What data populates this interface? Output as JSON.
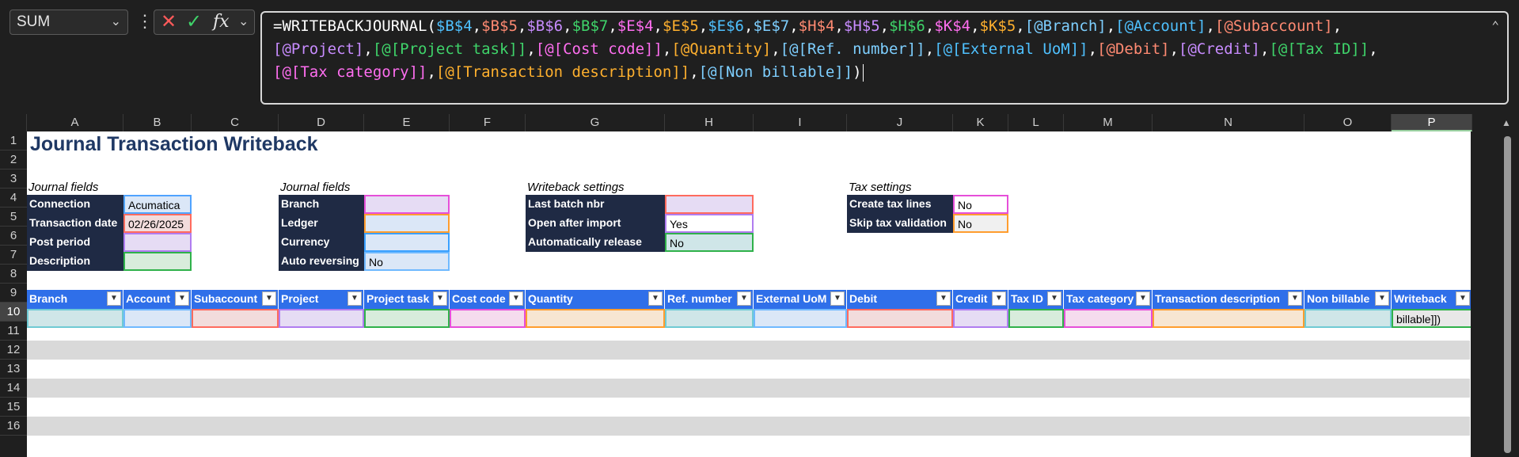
{
  "namebox": {
    "value": "SUM",
    "icon": "chevron-down-icon"
  },
  "formula_bar": {
    "menu_icon": "vertical-dots-icon",
    "cancel_icon": "cancel-x-icon",
    "enter_icon": "checkmark-icon",
    "fx_label": "fx",
    "fx_chevron": "chevron-down-icon",
    "collapse_icon": "chevron-up-icon",
    "tokens": [
      {
        "t": "=WRITEBACKJOURNAL(",
        "c": "w"
      },
      {
        "t": "$B$4",
        "c": "c1"
      },
      {
        "t": ",",
        "c": "w"
      },
      {
        "t": "$B$5",
        "c": "c2"
      },
      {
        "t": ",",
        "c": "w"
      },
      {
        "t": "$B$6",
        "c": "c7"
      },
      {
        "t": ",",
        "c": "w"
      },
      {
        "t": "$B$7",
        "c": "c3"
      },
      {
        "t": ",",
        "c": "w"
      },
      {
        "t": "$E$4",
        "c": "c4"
      },
      {
        "t": ",",
        "c": "w"
      },
      {
        "t": "$E$5",
        "c": "c5"
      },
      {
        "t": ",",
        "c": "w"
      },
      {
        "t": "$E$6",
        "c": "c1"
      },
      {
        "t": ",",
        "c": "w"
      },
      {
        "t": "$E$7",
        "c": "c6"
      },
      {
        "t": ",",
        "c": "w"
      },
      {
        "t": "$H$4",
        "c": "c2"
      },
      {
        "t": ",",
        "c": "w"
      },
      {
        "t": "$H$5",
        "c": "c7"
      },
      {
        "t": ",",
        "c": "w"
      },
      {
        "t": "$H$6",
        "c": "c3"
      },
      {
        "t": ",",
        "c": "w"
      },
      {
        "t": "$K$4",
        "c": "c4"
      },
      {
        "t": ",",
        "c": "w"
      },
      {
        "t": "$K$5",
        "c": "c5"
      },
      {
        "t": ",",
        "c": "w"
      },
      {
        "t": "[@Branch]",
        "c": "c6"
      },
      {
        "t": ",",
        "c": "w"
      },
      {
        "t": "[@Account]",
        "c": "c1"
      },
      {
        "t": ",",
        "c": "w"
      },
      {
        "t": "[@Subaccount]",
        "c": "c2"
      },
      {
        "t": ",\n",
        "c": "w"
      },
      {
        "t": "[@Project]",
        "c": "c7"
      },
      {
        "t": ",",
        "c": "w"
      },
      {
        "t": "[@[Project task]]",
        "c": "c3"
      },
      {
        "t": ",",
        "c": "w"
      },
      {
        "t": "[@[Cost code]]",
        "c": "c4"
      },
      {
        "t": ",",
        "c": "w"
      },
      {
        "t": "[@Quantity]",
        "c": "c5"
      },
      {
        "t": ",",
        "c": "w"
      },
      {
        "t": "[@[Ref. number]]",
        "c": "c6"
      },
      {
        "t": ",",
        "c": "w"
      },
      {
        "t": "[@[External UoM]]",
        "c": "c1"
      },
      {
        "t": ",",
        "c": "w"
      },
      {
        "t": "[@Debit]",
        "c": "c2"
      },
      {
        "t": ",",
        "c": "w"
      },
      {
        "t": "[@Credit]",
        "c": "c7"
      },
      {
        "t": ",",
        "c": "w"
      },
      {
        "t": "[@[Tax ID]]",
        "c": "c3"
      },
      {
        "t": ",\n",
        "c": "w"
      },
      {
        "t": "[@[Tax category]]",
        "c": "c4"
      },
      {
        "t": ",",
        "c": "w"
      },
      {
        "t": "[@[Transaction description]]",
        "c": "c5"
      },
      {
        "t": ",",
        "c": "w"
      },
      {
        "t": "[@[Non billable]]",
        "c": "c6"
      },
      {
        "t": ")",
        "c": "w"
      }
    ]
  },
  "columns": [
    "A",
    "B",
    "C",
    "D",
    "E",
    "F",
    "G",
    "H",
    "I",
    "J",
    "K",
    "L",
    "M",
    "N",
    "O",
    "P"
  ],
  "selected_column": "P",
  "rows": [
    "1",
    "2",
    "3",
    "4",
    "5",
    "6",
    "7",
    "8",
    "9",
    "10",
    "11",
    "12",
    "13",
    "14",
    "15",
    "16"
  ],
  "selected_row": "10",
  "sheet": {
    "title": "Journal Transaction Writeback",
    "journal_fields_1": {
      "header": "Journal fields",
      "items": [
        {
          "label": "Connection",
          "value": "Acumatica",
          "fill": "#dbe7f7",
          "border": "#4fa3ff"
        },
        {
          "label": "Transaction date",
          "value": "02/26/2025",
          "fill": "#f2dcdc",
          "border": "#ff6b5e"
        },
        {
          "label": "Post period",
          "value": "",
          "fill": "#e6dcf4",
          "border": "#b07cf0"
        },
        {
          "label": "Description",
          "value": "",
          "fill": "#d8ecdc",
          "border": "#2fb14a"
        }
      ]
    },
    "journal_fields_2": {
      "header": "Journal fields",
      "items": [
        {
          "label": "Branch",
          "value": "",
          "fill": "#e6dcf4",
          "border": "#e64fd9"
        },
        {
          "label": "Ledger",
          "value": "",
          "fill": "#dbe7f7",
          "border": "#ff9d2e"
        },
        {
          "label": "Currency",
          "value": "",
          "fill": "#dbe7f7",
          "border": "#39a0ff"
        },
        {
          "label": "Auto reversing",
          "value": "No",
          "fill": "#dbe7f7",
          "border": "#6fb9ff"
        }
      ]
    },
    "writeback_settings": {
      "header": "Writeback settings",
      "items": [
        {
          "label": "Last batch nbr",
          "value": "",
          "fill": "#e6dcf4",
          "border": "#ff6b5e"
        },
        {
          "label": "Open after import",
          "value": "Yes",
          "fill": "#ffffff",
          "border": "#b07cf0"
        },
        {
          "label": "Automatically release",
          "value": "No",
          "fill": "#cfe6e8",
          "border": "#2fb14a"
        }
      ]
    },
    "tax_settings": {
      "header": "Tax settings",
      "items": [
        {
          "label": "Create tax lines",
          "value": "No",
          "fill": "#ffffff",
          "border": "#e64fd9"
        },
        {
          "label": "Skip tax validation",
          "value": "No",
          "fill": "#f0f0f0",
          "border": "#ff9d2e"
        }
      ]
    },
    "table_headers": [
      "Branch",
      "Account",
      "Subaccount",
      "Project",
      "Project task",
      "Cost code",
      "Quantity",
      "Ref. number",
      "External UoM",
      "Debit",
      "Credit",
      "Tax ID",
      "Tax category",
      "Transaction description",
      "Non billable",
      "Writeback"
    ],
    "table_row_fills": [
      "#cfe6e8",
      "#dbe7f7",
      "#f2dcdc",
      "#e6dcf4",
      "#d8ecdc",
      "#f5dcee",
      "#f7e6d2",
      "#cfe6e8",
      "#dbe7f7",
      "#f2dcdc",
      "#e6dcf4",
      "#d8ecdc",
      "#f5dcee",
      "#f7e6d2",
      "#cfe6e8",
      "#e8e8e8"
    ],
    "table_row_borders": [
      "#6fcad4",
      "#6fb9ff",
      "#ff6b5e",
      "#b07cf0",
      "#2fb14a",
      "#e64fd9",
      "#ff9d2e",
      "#6fcad4",
      "#6fb9ff",
      "#ff6b5e",
      "#b07cf0",
      "#2fb14a",
      "#e64fd9",
      "#ff9d2e",
      "#6fcad4",
      "#2fb14a"
    ],
    "writeback_cell_value": "billable]])"
  }
}
